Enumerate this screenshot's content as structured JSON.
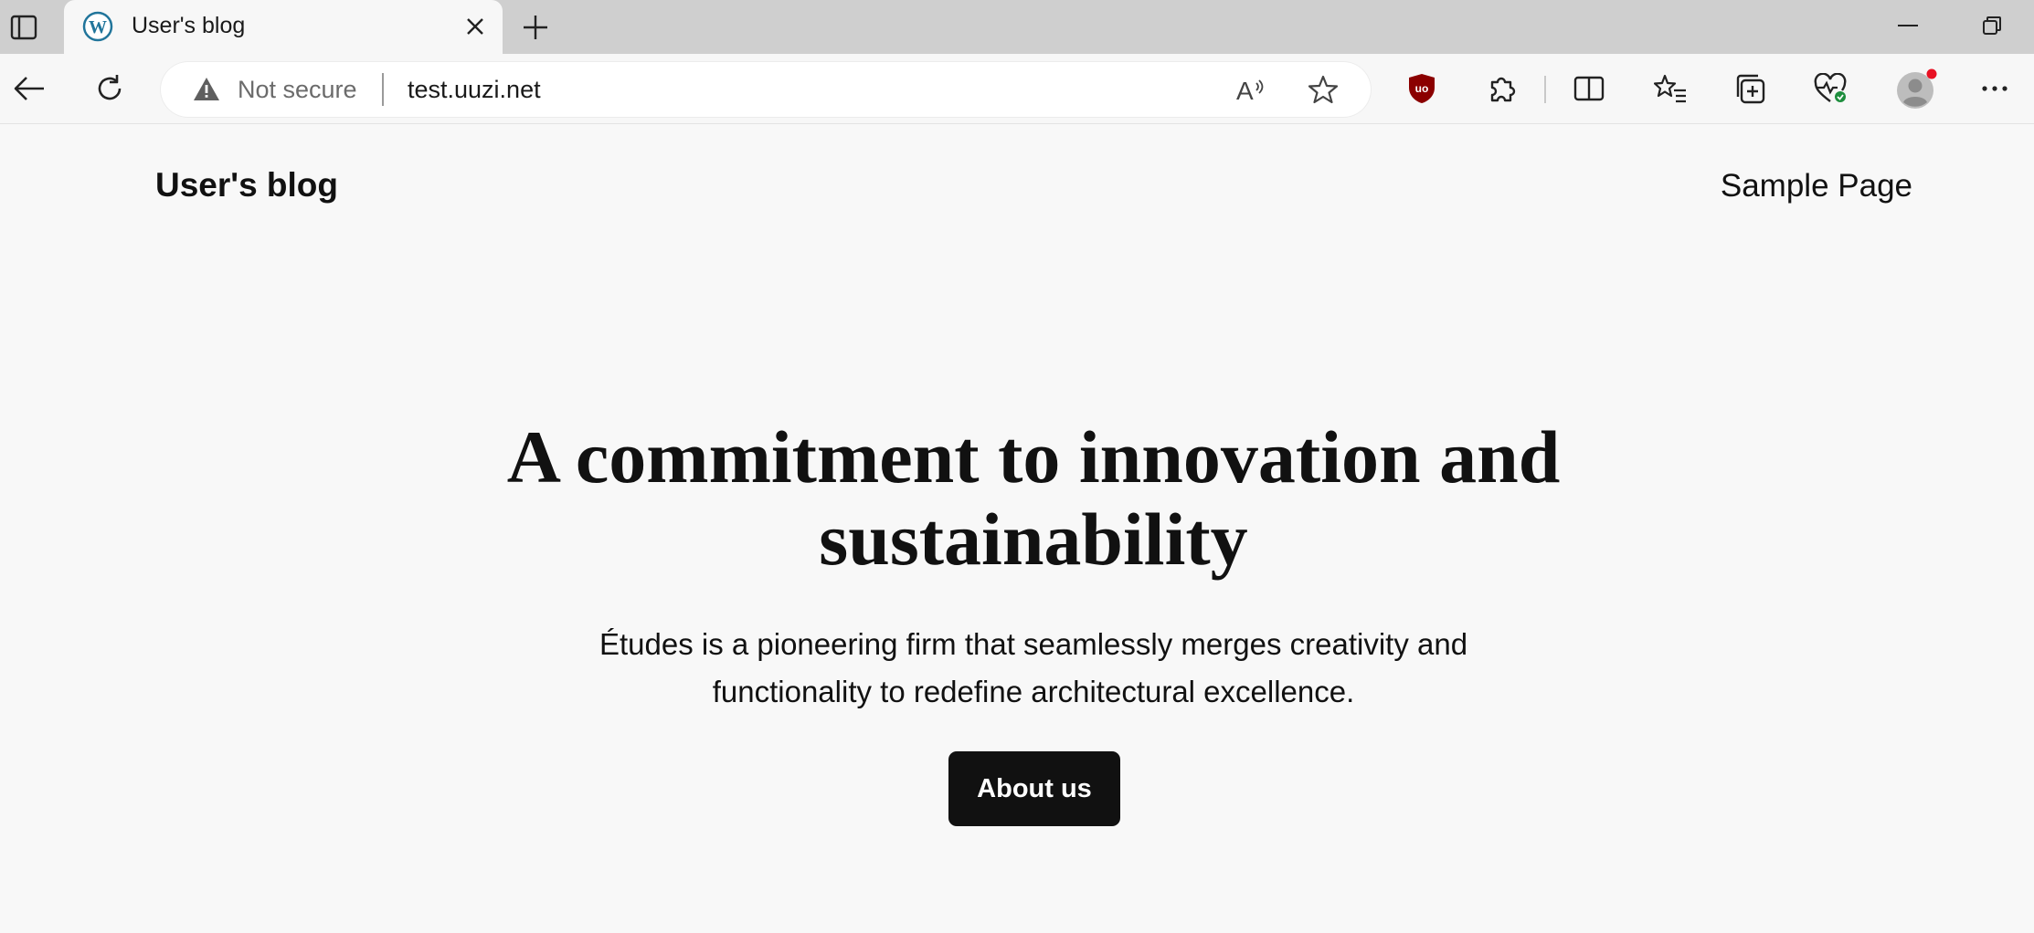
{
  "browser": {
    "tab": {
      "title": "User's blog",
      "favicon": "wordpress-icon"
    },
    "address_bar": {
      "security_text": "Not secure",
      "url": "test.uuzi.net"
    },
    "icons": {
      "tab_actions": "tab-actions-icon",
      "close": "close-icon",
      "new_tab": "plus-icon",
      "back": "back-arrow-icon",
      "refresh": "refresh-icon",
      "warning": "warning-icon",
      "read_aloud": "read-aloud-icon",
      "favorite": "star-icon",
      "ublock": "ublock-shield-icon",
      "extensions": "puzzle-icon",
      "split_screen": "split-screen-icon",
      "favorites": "favorites-list-icon",
      "collections": "collections-icon",
      "performance": "heartbeat-icon",
      "profile": "profile-avatar-icon",
      "more": "more-icon",
      "minimize": "minimize-icon",
      "restore": "restore-icon"
    },
    "colors": {
      "ublock_red": "#8b0000",
      "profile_badge": "#e81123",
      "performance_badge": "#1e8e3e",
      "wordpress_blue": "#21759b"
    }
  },
  "page": {
    "site_title": "User's blog",
    "nav": {
      "sample_page": "Sample Page"
    },
    "hero": {
      "title_line1": "A commitment to innovation and",
      "title_line2": "sustainability",
      "subtitle_line1": "Études is a pioneering firm that seamlessly merges creativity and",
      "subtitle_line2": "functionality to redefine architectural excellence.",
      "button_label": "About us"
    }
  }
}
